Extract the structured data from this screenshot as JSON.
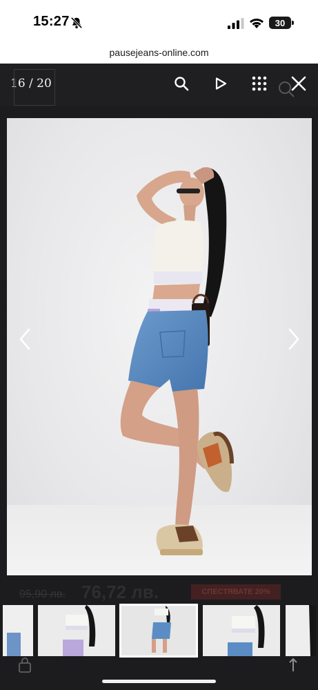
{
  "status_bar": {
    "time": "15:27",
    "battery": "30"
  },
  "browser": {
    "url": "pausejeans-online.com"
  },
  "gallery": {
    "counter": "16 / 20",
    "accent": "#1f1f21",
    "icons": [
      "search-icon",
      "play-icon",
      "grid-icon",
      "close-icon",
      "chevron-left-icon",
      "chevron-right-icon"
    ]
  },
  "product": {
    "old_price": "95,90 лв.",
    "new_price": "76,72 лв.",
    "badge": "СПЕСТЯВАТЕ 20%"
  }
}
